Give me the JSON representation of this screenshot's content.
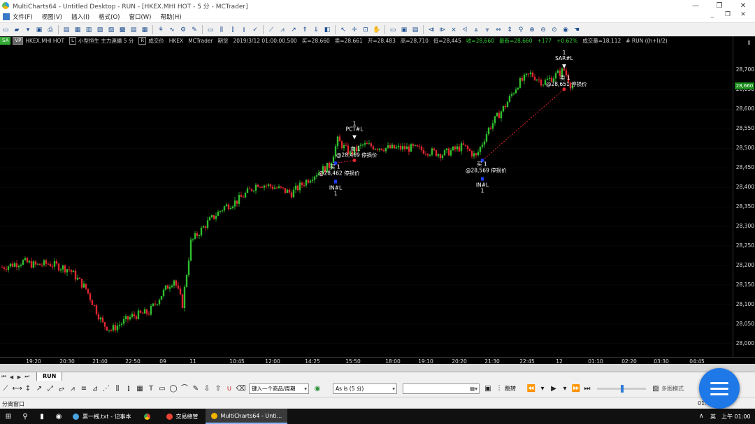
{
  "window": {
    "title": "MultiCharts64 - Untitled Desktop - RUN - [HKEX.MHI HOT - 5 分 - MCTrader]"
  },
  "menu": [
    "文件(F)",
    "视图(V)",
    "插入(I)",
    "格式(O)",
    "窗口(W)",
    "帮助(H)"
  ],
  "status": {
    "sa": "SA",
    "vp": "VP",
    "symbol": "HKEX.MHI HOT",
    "bar_info": "小型恒生 主力連續 5 分",
    "vol_label": "成交价",
    "exchange": "HKEX",
    "broker": "MCTrader",
    "period": "期货",
    "datetime": "2019/3/12 01:00:00.500",
    "buy": "买=28,660",
    "sell": "卖=28,661",
    "open": "开=28,483",
    "high": "高=28,710",
    "low": "低=28,445",
    "close": "收=28,660",
    "last": "最新=28,660",
    "change": "+177",
    "pct": "+0.62%",
    "volume": "成交量=18,112",
    "run_label": "# RUN ((h+l)/2)"
  },
  "chart_data": {
    "type": "candlestick",
    "symbol": "HKEX.MHI HOT",
    "interval": "5 分",
    "ylim": [
      27980,
      28740
    ],
    "y_ticks": [
      28000,
      28050,
      28100,
      28150,
      28200,
      28250,
      28300,
      28350,
      28400,
      28450,
      28500,
      28550,
      28600,
      28650,
      28700
    ],
    "y_tick_labels": [
      "28,000",
      "28,050",
      "28,100",
      "28,150",
      "28,200",
      "28,250",
      "28,300",
      "28,350",
      "28,400",
      "28,450",
      "28,500",
      "28,550",
      "28,600",
      "28,650",
      "28,700"
    ],
    "last_price_label": "28,660",
    "last_price": 28660,
    "x_labels": [
      "19:20",
      "20:30",
      "21:40",
      "22:50",
      "09",
      "11",
      "10:45",
      "12:00",
      "14:25",
      "15:50",
      "18:00",
      "19:10",
      "20:20",
      "21:30",
      "22:45",
      "12",
      "01:10",
      "02:20",
      "03:30",
      "04:45"
    ],
    "bar_count": 340,
    "path": [
      [
        0,
        28195
      ],
      [
        10,
        28210
      ],
      [
        16,
        28200
      ],
      [
        22,
        28205
      ],
      [
        32,
        28190
      ],
      [
        40,
        28140
      ],
      [
        48,
        28050
      ],
      [
        52,
        28035
      ],
      [
        62,
        28070
      ],
      [
        70,
        28080
      ],
      [
        78,
        28140
      ],
      [
        82,
        28165
      ],
      [
        86,
        28100
      ],
      [
        90,
        28260
      ],
      [
        98,
        28310
      ],
      [
        106,
        28350
      ],
      [
        112,
        28365
      ],
      [
        122,
        28410
      ],
      [
        130,
        28400
      ],
      [
        138,
        28385
      ],
      [
        148,
        28430
      ],
      [
        156,
        28455
      ],
      [
        160,
        28520
      ],
      [
        166,
        28485
      ],
      [
        172,
        28508
      ],
      [
        184,
        28500
      ],
      [
        196,
        28500
      ],
      [
        210,
        28485
      ],
      [
        220,
        28505
      ],
      [
        226,
        28478
      ],
      [
        232,
        28550
      ],
      [
        240,
        28610
      ],
      [
        246,
        28665
      ],
      [
        252,
        28690
      ],
      [
        258,
        28668
      ],
      [
        268,
        28700
      ],
      [
        272,
        28652
      ]
    ],
    "orders": [
      {
        "kind": "buy",
        "bar": 159,
        "price": 28462,
        "label": "买 1",
        "price_label": "@28,462 停损价",
        "tag": "IN#L",
        "qty": "1"
      },
      {
        "kind": "sell",
        "bar": 168,
        "price": 28469,
        "label": "卖 1",
        "price_label": "@28,469 停损价",
        "tag": "PCT#L",
        "qty": "1"
      },
      {
        "kind": "buy",
        "bar": 229,
        "price": 28469,
        "label": "买 1",
        "price_label": "@28,569 停损价",
        "tag": "IN#L",
        "qty": "1"
      },
      {
        "kind": "sell",
        "bar": 268,
        "price": 28651,
        "label": "卖 1",
        "price_label": "@28,651 停损价",
        "tag": "SAR#L",
        "qty": "1"
      }
    ]
  },
  "tabs": [
    "RUN"
  ],
  "drawbar": {
    "symbol_placeholder": "键入一个商品/周期",
    "resolution": "As is (5 分)",
    "jump_label": "跳转",
    "multi_label": "多图模式"
  },
  "statusbar": {
    "text": "分离窗口",
    "time": "01:00"
  },
  "taskbar": {
    "tasks": [
      {
        "label": "票一桟.txt - 记事本",
        "color": "#4aa3df"
      },
      {
        "label": "",
        "color": "#e94235"
      },
      {
        "label": "交易總管",
        "color": "#e94235"
      },
      {
        "label": "MultiCharts64 - Unti...",
        "color": "#f0b400",
        "active": true
      }
    ],
    "ime": "英",
    "clock": "上午 01:00"
  },
  "colors": {
    "up": "#2fbf2f",
    "down": "#e0262f",
    "background": "#000000"
  }
}
